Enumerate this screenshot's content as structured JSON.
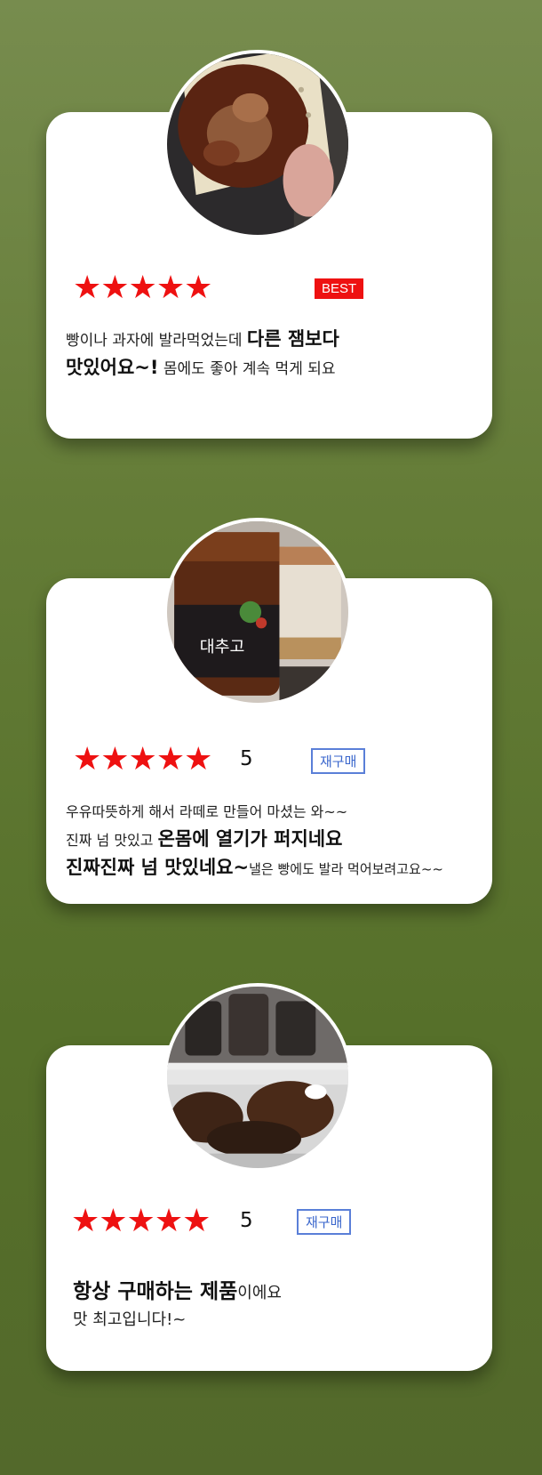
{
  "reviews": [
    {
      "stars": "★★★★★",
      "badge": "BEST",
      "line1_normal": "빵이나 과자에 발라먹었는데 ",
      "line1_bold": "다른 잼보다",
      "line2_bold": "맛있어요~!",
      "line2_normal": " 몸에도 좋아 계속 먹게 되요"
    },
    {
      "stars": "★★★★★",
      "score": "5",
      "badge": "재구매",
      "jar_label": "대추고",
      "line1_normal": "우유따뜻하게 해서 라떼로 만들어 마셨는 와~~",
      "line2_normal": "진짜 넘 맛있고 ",
      "line2_bold": "온몸에 열기가 퍼지네요",
      "line3_bold": "진짜진짜 넘 맛있네요~",
      "line3_normal": "낼은 빵에도 발라 먹어보려고요~~"
    },
    {
      "stars": "★★★★★",
      "score": "5",
      "badge": "재구매",
      "line1_bold": "항상 구매하는 제품",
      "line1_normal": "이에요",
      "line2_normal": "맛 최고입니다!~"
    }
  ],
  "colors": {
    "star": "#ee1111",
    "best_badge": "#ee1111",
    "rebuy_border": "#5a7fd8"
  }
}
